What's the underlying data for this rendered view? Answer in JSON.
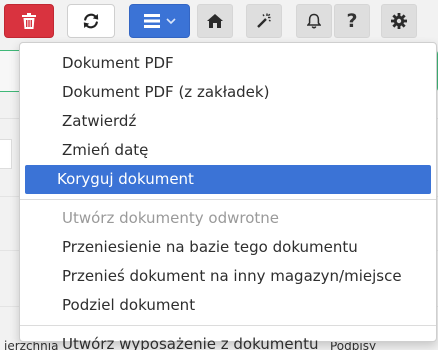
{
  "toolbar": {
    "buttons": [
      {
        "name": "delete",
        "icon": "trash-icon",
        "color": "#d9333f"
      },
      {
        "name": "refresh",
        "icon": "refresh-icon"
      },
      {
        "name": "menu",
        "icon": "hamburger-icon",
        "color": "#3b73d6"
      },
      {
        "name": "home",
        "icon": "home-icon"
      },
      {
        "name": "wand",
        "icon": "magic-wand-icon"
      },
      {
        "name": "notifications",
        "icon": "bell-icon"
      },
      {
        "name": "help",
        "icon": "question-icon",
        "label": "?"
      },
      {
        "name": "settings",
        "icon": "gear-icon"
      }
    ]
  },
  "dropdown": {
    "groups": [
      {
        "items": [
          {
            "label": "Dokument PDF",
            "state": "normal"
          },
          {
            "label": "Dokument PDF (z zakładek)",
            "state": "normal"
          },
          {
            "label": "Zatwierdź",
            "state": "normal"
          },
          {
            "label": "Zmień datę",
            "state": "normal"
          },
          {
            "label": "Koryguj dokument",
            "state": "active"
          }
        ]
      },
      {
        "items": [
          {
            "label": "Utwórz dokumenty odwrotne",
            "state": "disabled"
          },
          {
            "label": "Przeniesienie na bazie tego dokumentu",
            "state": "normal"
          },
          {
            "label": "Przenieś dokument na inny magazyn/miejsce",
            "state": "normal"
          },
          {
            "label": "Podziel dokument",
            "state": "normal"
          }
        ]
      },
      {
        "items": [
          {
            "label": "Utwórz wyposażenie z dokumentu",
            "state": "normal"
          }
        ]
      }
    ]
  },
  "background": {
    "left_text": "ierzchnia",
    "right_text": "Podpisy"
  },
  "colors": {
    "accent": "#3b73d6",
    "danger": "#d9333f",
    "success_border": "#3fb878"
  }
}
